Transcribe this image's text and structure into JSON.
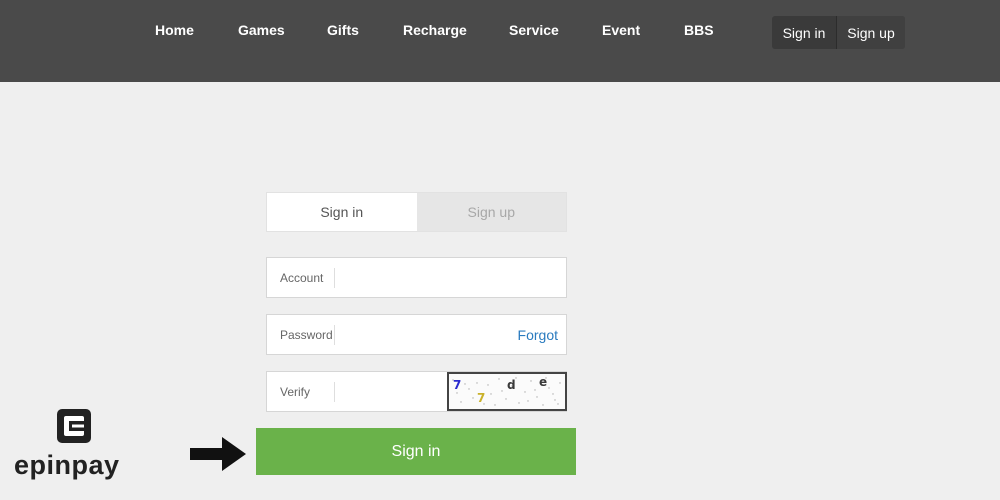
{
  "nav": {
    "items": [
      {
        "label": "Home"
      },
      {
        "label": "Games"
      },
      {
        "label": "Gifts"
      },
      {
        "label": "Recharge"
      },
      {
        "label": "Service"
      },
      {
        "label": "Event"
      },
      {
        "label": "BBS"
      }
    ],
    "sign_in": "Sign in",
    "sign_up": "Sign up"
  },
  "form": {
    "tabs": {
      "sign_in": "Sign in",
      "sign_up": "Sign up"
    },
    "account": {
      "label": "Account",
      "value": ""
    },
    "password": {
      "label": "Password",
      "value": "",
      "forgot": "Forgot"
    },
    "verify": {
      "label": "Verify",
      "value": "",
      "captcha_chars": [
        "7",
        "7",
        "d",
        "e"
      ]
    },
    "submit": "Sign in"
  },
  "overlay": {
    "brand_name": "epinpay",
    "arrow_icon": "right-arrow-icon"
  },
  "colors": {
    "topbar": "#4a4a4a",
    "page_bg": "#efefef",
    "submit_green": "#6ab24a",
    "forgot_link": "#2a7bbf"
  }
}
